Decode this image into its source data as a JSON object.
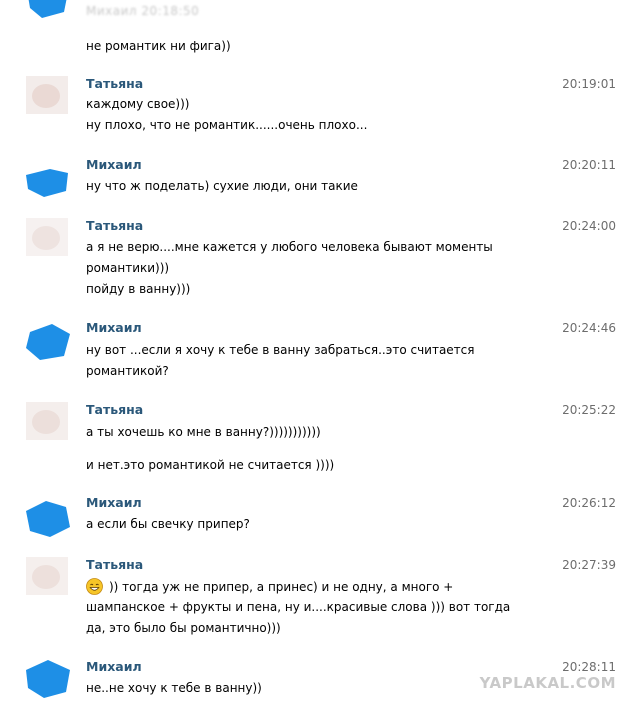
{
  "top": {
    "faded_text": "Михаил                                           20:18:50",
    "line": "не романтик ни фига))"
  },
  "colors": {
    "name": "#2b587a",
    "time": "#6d6d6d",
    "redacted_avatar": "#1e8fe6"
  },
  "messages": [
    {
      "name": "Татьяна",
      "time": "20:19:01",
      "lines": [
        "каждому свое)))",
        "ну плохо, что не романтик......очень плохо..."
      ]
    },
    {
      "name": "Михаил",
      "time": "20:20:11",
      "lines": [
        "ну что ж поделать) сухие люди, они такие"
      ]
    },
    {
      "name": "Татьяна",
      "time": "20:24:00",
      "lines": [
        "а я не верю....мне кажется у любого человека бывают моменты",
        "романтики)))",
        "пойду в ванну)))"
      ]
    },
    {
      "name": "Михаил",
      "time": "20:24:46",
      "lines": [
        "ну вот ...если я хочу к тебе в ванну забраться..это считается",
        "романтикой?"
      ]
    },
    {
      "name": "Татьяна",
      "time": "20:25:22",
      "lines": [
        "а ты хочешь ко мне в ванну?)))))))))))",
        "и нет.это романтикой не считается ))))"
      ]
    },
    {
      "name": "Михаил",
      "time": "20:26:12",
      "lines": [
        "а если бы свечку припер?"
      ]
    },
    {
      "name": "Татьяна",
      "time": "20:27:39",
      "lines": [
        ")) тогда уж не припер, а принес) и не одну, а много +",
        "шампанское + фрукты и пена, ну и....красивые слова ))) вот тогда",
        "да, это было бы романтично)))"
      ]
    },
    {
      "name": "Михаил",
      "time": "20:28:11",
      "lines": [
        "не..не хочу к тебе в ванну))"
      ]
    }
  ],
  "watermark": "YAPLAKAL.COM"
}
